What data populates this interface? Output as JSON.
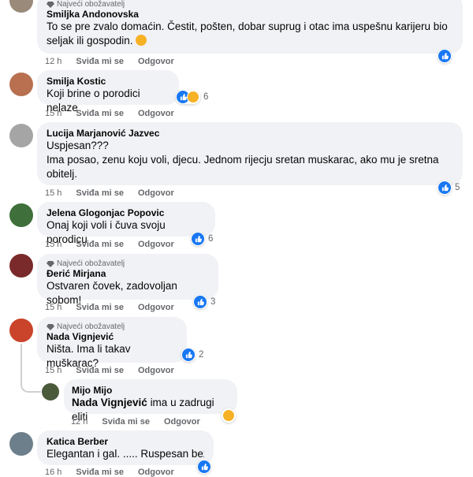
{
  "fan_badge": "Najveći obožavatelj",
  "actions": {
    "like": "Sviđa mi se",
    "reply": "Odgovor"
  },
  "comments": [
    {
      "name": "Smiljka Andonovska",
      "text": "To se pre zvalo domaćin. Čestit, pošten, dobar suprug i otac ima uspešnu karijeru bio seljak ili gospodin.",
      "time": "12 h",
      "count": ""
    },
    {
      "name": "Smilja Kostic",
      "text": "Koji brine o porodici nelaze",
      "time": "15 h",
      "count": "6"
    },
    {
      "name": "Lucija Marjanović Jazvec",
      "text_line1": "Uspjesan???",
      "text": "Ima posao, zenu koju voli, djecu. Jednom rijecju sretan muskarac, ako mu je sretna obitelj.",
      "time": "15 h",
      "count": "5"
    },
    {
      "name": "Jelena Glogonjac Popovic",
      "text": "Onaj koji voli i čuva svoju porodicu",
      "time": "15 h",
      "count": "6"
    },
    {
      "name": "Đerić Mirjana",
      "text": "Ostvaren čovek, zadovoljan sobom!",
      "time": "15 h",
      "count": "3"
    },
    {
      "name": "Nada Vignjević",
      "text": "Ništa. Ima li takav muškarac?",
      "time": "15 h",
      "count": "2"
    },
    {
      "name": "Mijo Mijo",
      "mention": "Nada Vignjević",
      "text": "ima u zadrugi eliti",
      "time": "12 h",
      "count": ""
    },
    {
      "name": "Katica Berber",
      "text": "Elegantan i gal. ..... Ruspesan bez p",
      "time": "16 h",
      "count": ""
    }
  ],
  "colors": {
    "bubble": "#f0f2f5",
    "like": "#1877f2",
    "haha": "#f7b125",
    "meta": "#65676b"
  }
}
